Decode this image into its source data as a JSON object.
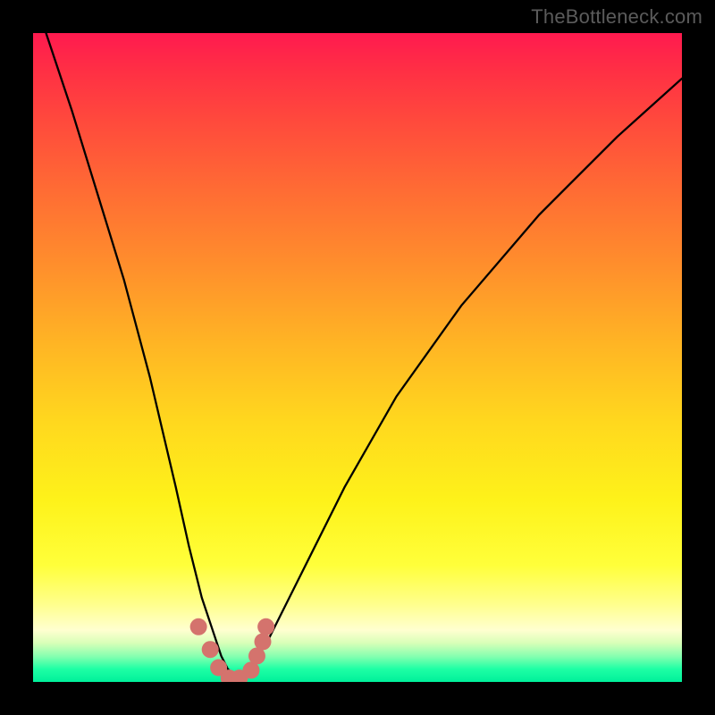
{
  "watermark": {
    "text": "TheBottleneck.com"
  },
  "chart_data": {
    "type": "line",
    "title": "",
    "xlabel": "",
    "ylabel": "",
    "xlim": [
      0,
      100
    ],
    "ylim": [
      0,
      100
    ],
    "background_gradient": {
      "top_color": "#ff1a4f",
      "bottom_color": "#00f09a",
      "meaning": "red=high bottleneck, green=low bottleneck"
    },
    "series": [
      {
        "name": "bottleneck-curve",
        "x": [
          2,
          6,
          10,
          14,
          18,
          22,
          24,
          26,
          28,
          29,
          30,
          31,
          32,
          33,
          34,
          36,
          38,
          42,
          48,
          56,
          66,
          78,
          90,
          100
        ],
        "values": [
          100,
          88,
          75,
          62,
          47,
          30,
          21,
          13,
          7,
          4,
          2,
          1,
          1,
          2,
          3,
          6,
          10,
          18,
          30,
          44,
          58,
          72,
          84,
          93
        ]
      },
      {
        "name": "sample-points",
        "x": [
          25.5,
          27.3,
          28.6,
          30.2,
          31.8,
          33.6,
          34.5,
          35.4,
          35.9
        ],
        "values": [
          8.5,
          5.0,
          2.2,
          0.6,
          0.6,
          1.8,
          4.0,
          6.2,
          8.5
        ]
      }
    ],
    "colors": {
      "curve": "#000000",
      "points": "#d4736d"
    }
  }
}
